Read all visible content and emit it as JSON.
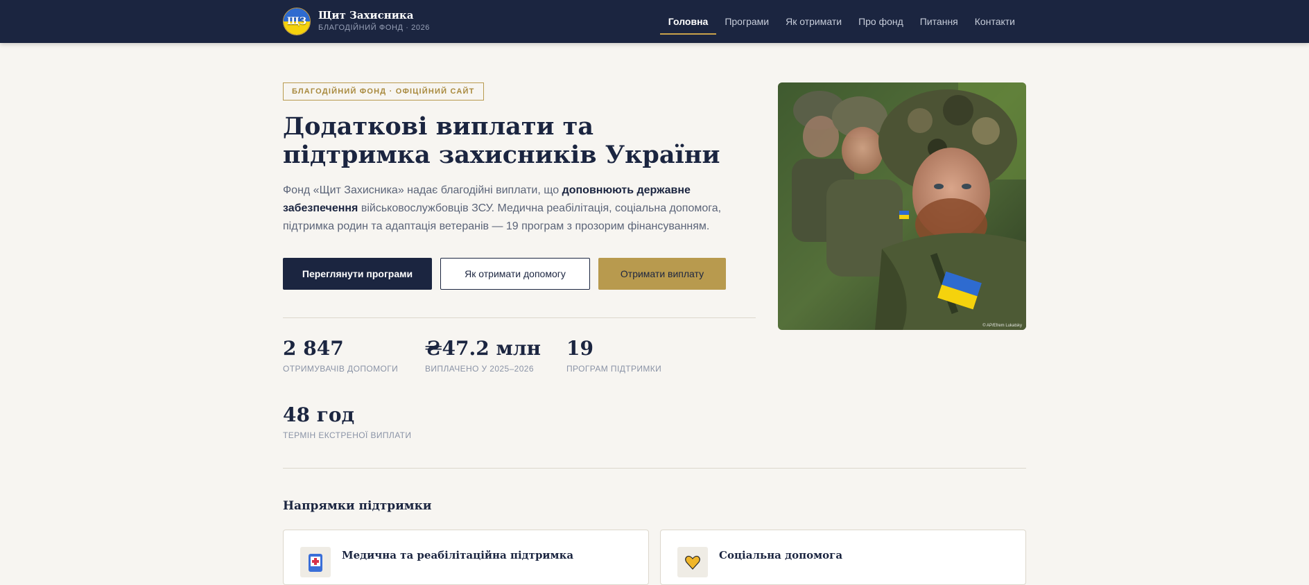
{
  "header": {
    "logo_text": "ЩЗ",
    "brand_name": "Щит Захисника",
    "brand_sub": "БЛАГОДІЙНИЙ ФОНД · 2026",
    "nav": [
      {
        "label": "Головна",
        "active": true
      },
      {
        "label": "Програми"
      },
      {
        "label": "Як отримати"
      },
      {
        "label": "Про фонд"
      },
      {
        "label": "Питання"
      },
      {
        "label": "Контакти"
      }
    ]
  },
  "hero": {
    "badge": "БЛАГОДІЙНИЙ ФОНД · ОФІЦІЙНИЙ САЙТ",
    "title": "Додаткові виплати та підтримка захисників України",
    "lead_part1": "Фонд «Щит Захисника» надає благодійні виплати, що ",
    "lead_bold": "доповнюють державне забезпечення",
    "lead_part2": " військовослужбовців ЗСУ. Медична реабілітація, соціальна допомога, підтримка родин та адаптація ветеранів — 19 програм з прозорим фінансуванням.",
    "buttons": {
      "primary": "Переглянути програми",
      "secondary": "Як отримати допомогу",
      "tertiary": "Отримати виплату"
    },
    "image_credit": "© AP/Efrem Lukatsky"
  },
  "stats": [
    {
      "value": "2 847",
      "label": "ОТРИМУВАЧІВ ДОПОМОГИ"
    },
    {
      "value": "₴47.2 млн",
      "label": "ВИПЛАЧЕНО У 2025–2026"
    },
    {
      "value": "19",
      "label": "ПРОГРАМ ПІДТРИМКИ"
    },
    {
      "value": "48 год",
      "label": "ТЕРМІН ЕКСТРЕНОЇ ВИПЛАТИ"
    }
  ],
  "directions": {
    "title": "Напрямки підтримки",
    "cards": [
      {
        "title": "Медична та реабілітаційна підтримка",
        "icon": "medical-icon"
      },
      {
        "title": "Соціальна допомога",
        "icon": "heart-hand-icon"
      }
    ]
  },
  "colors": {
    "navy": "#1b2540",
    "gold": "#b89a4e",
    "background": "#f7f5f1",
    "flag_blue": "#2e6bd0",
    "flag_yellow": "#f5d20d"
  }
}
